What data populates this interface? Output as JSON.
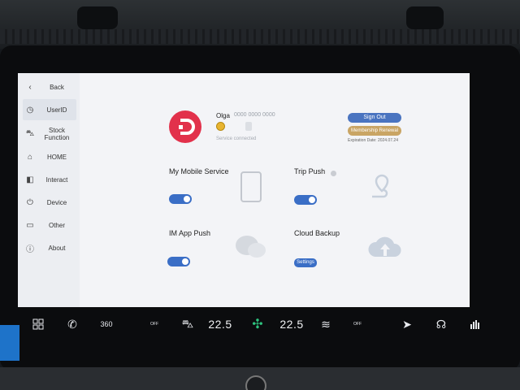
{
  "sidebar": {
    "items": [
      {
        "label": "Back",
        "icon": "chevron-left-icon"
      },
      {
        "label": "UserID",
        "icon": "user-id-icon"
      },
      {
        "label": "Stock Function",
        "icon": "car-icon"
      },
      {
        "label": "HOME",
        "icon": "home-icon"
      },
      {
        "label": "Interact",
        "icon": "interact-icon"
      },
      {
        "label": "Device",
        "icon": "device-icon"
      },
      {
        "label": "Other",
        "icon": "other-icon"
      },
      {
        "label": "About",
        "icon": "info-icon"
      }
    ]
  },
  "user": {
    "name": "Olga",
    "id": "0000 0000 0000",
    "status": "Service connected"
  },
  "account": {
    "sign_out": "Sign Out",
    "renewal": "Membership Renewal",
    "expiration": "Expiration Date: 2024.07.24"
  },
  "services": {
    "my_mobile_service": {
      "label": "My Mobile Service",
      "enabled": true
    },
    "trip_push": {
      "label": "Trip Push",
      "enabled": true
    },
    "im_app_push": {
      "label": "IM App Push",
      "enabled": true
    },
    "cloud_backup": {
      "label": "Cloud Backup",
      "button": "Settings"
    }
  },
  "climate_bar": {
    "left_temp": "22.5",
    "right_temp": "22.5",
    "icons": [
      "apps-grid-icon",
      "phone-icon",
      "360-camera-icon",
      "seat-heat-off-icon",
      "car-airflow-icon",
      "fan-icon",
      "defrost-icon",
      "seat-heat-off-icon",
      "navigation-icon",
      "headrest-icon",
      "equalizer-icon"
    ],
    "camera_label": "360",
    "off_label": "OFF"
  },
  "colors": {
    "accent_blue": "#3a6ec6",
    "logo_red": "#e2314b",
    "gold": "#c9a565",
    "fan_green": "#2ec27e"
  }
}
